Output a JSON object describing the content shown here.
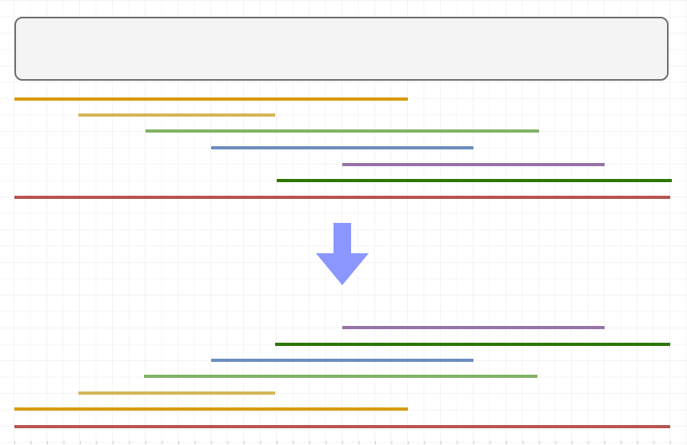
{
  "colors": {
    "orange": "#d79b00",
    "yellow": "#d6b656",
    "light_green": "#82b366",
    "blue": "#6c8ebf",
    "purple": "#9673a6",
    "dark_green": "#2d7600",
    "red": "#b85450",
    "arrow": "#8b96ff",
    "box_fill": "#f4f4f4",
    "box_border": "#6e6e6e"
  },
  "arrow": {
    "icon": "down-arrow-icon"
  },
  "top_group": {
    "bars": [
      {
        "name": "orange-bar",
        "color_key": "orange"
      },
      {
        "name": "yellow-bar",
        "color_key": "yellow"
      },
      {
        "name": "light-green-bar",
        "color_key": "light_green"
      },
      {
        "name": "blue-bar",
        "color_key": "blue"
      },
      {
        "name": "purple-bar",
        "color_key": "purple"
      },
      {
        "name": "dark-green-bar",
        "color_key": "dark_green"
      },
      {
        "name": "red-bar",
        "color_key": "red"
      }
    ]
  },
  "bottom_group": {
    "bars": [
      {
        "name": "purple-bar",
        "color_key": "purple"
      },
      {
        "name": "dark-green-bar",
        "color_key": "dark_green"
      },
      {
        "name": "blue-bar",
        "color_key": "blue"
      },
      {
        "name": "light-green-bar",
        "color_key": "light_green"
      },
      {
        "name": "yellow-bar",
        "color_key": "yellow"
      },
      {
        "name": "orange-bar",
        "color_key": "orange"
      },
      {
        "name": "red-bar",
        "color_key": "red"
      }
    ]
  }
}
